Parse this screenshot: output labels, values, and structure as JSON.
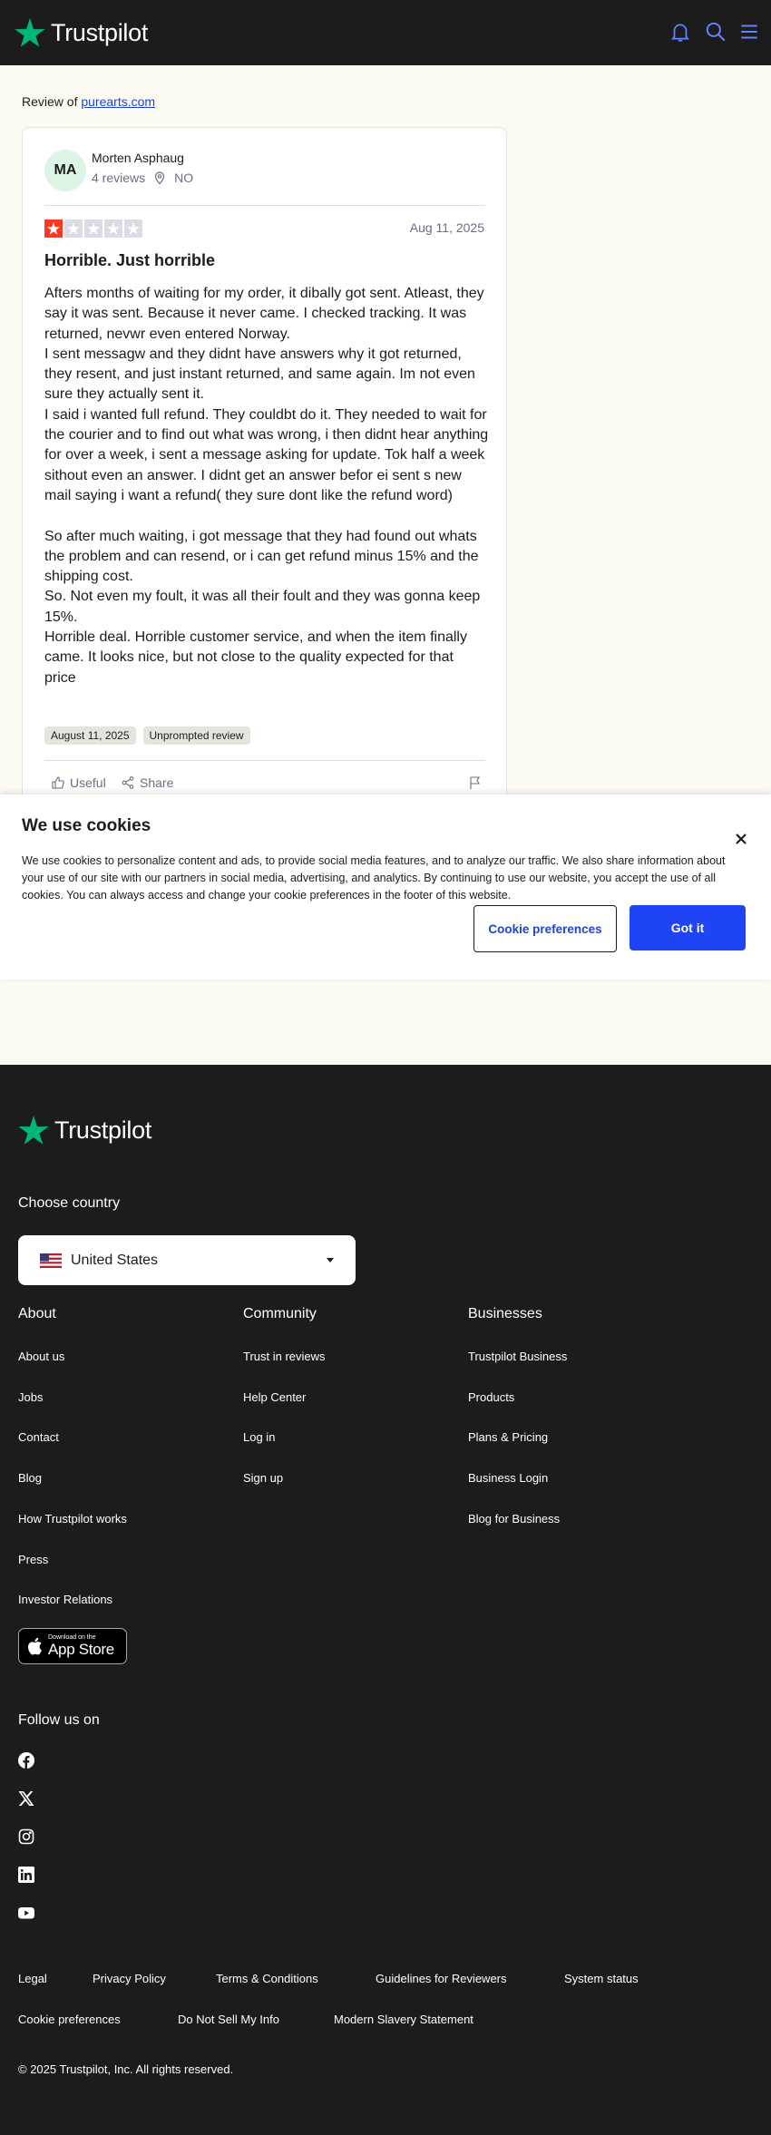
{
  "header": {
    "brand": "Trustpilot",
    "colors": {
      "background": "#1c1c1c",
      "brand_green": "#00b67a",
      "icon_blue": "#5f86ff"
    },
    "icons": [
      "bell-icon",
      "search-icon",
      "menu-icon"
    ]
  },
  "review_of": {
    "prefix": "Review of",
    "business": "purearts.com"
  },
  "review": {
    "author": {
      "initials": "MA",
      "name": "Morten Asphaug",
      "reviews_count": "4 reviews",
      "country": "NO"
    },
    "rating": 1,
    "max_rating": 5,
    "date": "Aug 11, 2025",
    "title": "Horrible. Just horrible",
    "body": [
      "Afters months of waiting for my order, it dibally got sent. Atleast, they say it was sent. Because it never came. I checked tracking. It was returned, nevwr even entered Norway.",
      "I sent messagw and they didnt have answers why it got returned, they resent, and just instant returned, and same again. Im not even sure they actually sent it.",
      "I said i wanted full refund. They couldbt do it. They needed to wait for the courier and to find out what was wrong, i then didnt hear anything for over a week, i sent a message asking for update. Tok half a week sithout even an answer. I didnt get an answer befor ei sent s new mail saying i want a refund( they sure dont like the refund word)",
      "",
      "So after much waiting, i got message that they had found out whats the problem and can resend, or i can get refund minus 15% and the shipping cost.",
      "So. Not even my foult, it was all their foult and they was gonna keep 15%.",
      "Horrible deal. Horrible customer service, and when the item finally came. It looks nice, but not close to the quality expected for that price"
    ],
    "tags": [
      "August 11, 2025",
      "Unprompted review"
    ],
    "actions": {
      "useful": "Useful",
      "share": "Share"
    },
    "colors": {
      "star_on": "#ff3722",
      "star_off": "#dcdce6"
    }
  },
  "cookie_banner": {
    "title": "We use cookies",
    "text": "We use cookies to personalize content and ads, to provide social media features, and to analyze our traffic. We also share information about your use of our site with our partners in social media, advertising, and analytics. By continuing to use our website, you accept the use of all cookies. You can always access and change your cookie preferences in the footer of this website.",
    "preferences_button": "Cookie preferences",
    "accept_button": "Got it",
    "colors": {
      "accept_bg": "#1f44f4",
      "preferences_text": "#1f44d4"
    }
  },
  "footer": {
    "brand": "Trustpilot",
    "choose_country_label": "Choose country",
    "country_selected": "United States",
    "columns": [
      {
        "title": "About",
        "links": [
          "About us",
          "Jobs",
          "Contact",
          "Blog",
          "How Trustpilot works",
          "Press",
          "Investor Relations"
        ]
      },
      {
        "title": "Community",
        "links": [
          "Trust in reviews",
          "Help Center",
          "Log in",
          "Sign up"
        ]
      },
      {
        "title": "Businesses",
        "links": [
          "Trustpilot Business",
          "Products",
          "Plans & Pricing",
          "Business Login",
          "Blog for Business"
        ]
      }
    ],
    "app_store": {
      "line1": "Download on the",
      "line2": "App Store"
    },
    "follow_label": "Follow us on",
    "social_icons": [
      "facebook-icon",
      "x-icon",
      "instagram-icon",
      "linkedin-icon",
      "youtube-icon"
    ],
    "legal_links_row1": [
      "Legal",
      "Privacy Policy",
      "Terms & Conditions",
      "Guidelines for Reviewers",
      "System status"
    ],
    "legal_links_row2": [
      "Cookie preferences",
      "Do Not Sell My Info",
      "Modern Slavery Statement"
    ],
    "copyright": "© 2025 Trustpilot, Inc. All rights reserved."
  }
}
